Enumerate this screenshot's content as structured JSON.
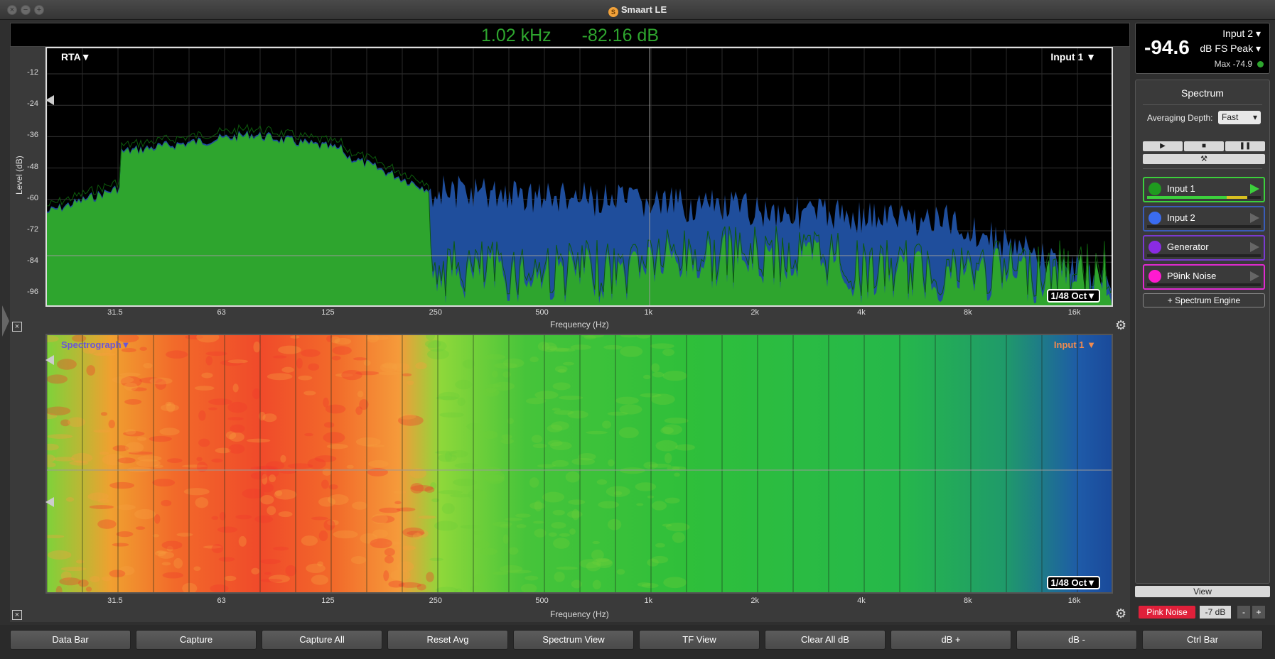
{
  "window": {
    "title": "Smaart LE"
  },
  "readout": {
    "frequency": "1.02 kHz",
    "level": "-82.16 dB"
  },
  "rta": {
    "type_label": "RTA",
    "input_label": "Input 1",
    "resolution": "1/48 Oct",
    "y_label": "Level (dB)",
    "x_label": "Frequency (Hz)",
    "y_ticks": [
      "-12",
      "-24",
      "-36",
      "-48",
      "-60",
      "-72",
      "-84",
      "-96"
    ],
    "x_ticks": [
      "31.5",
      "63",
      "125",
      "250",
      "500",
      "1k",
      "2k",
      "4k",
      "8k",
      "16k"
    ]
  },
  "spectrograph": {
    "type_label": "Spectrograph",
    "input_label": "Input 1",
    "resolution": "1/48 Oct",
    "x_label": "Frequency (Hz)",
    "x_ticks": [
      "31.5",
      "63",
      "125",
      "250",
      "500",
      "1k",
      "2k",
      "4k",
      "8k",
      "16k"
    ]
  },
  "meter": {
    "value": "-94.6",
    "input_select": "Input 2",
    "mode_select": "dB FS Peak",
    "max": "Max -74.9",
    "status_color": "#2ea52e"
  },
  "side_panel": {
    "title": "Spectrum",
    "averaging_label": "Averaging Depth:",
    "averaging_value": "Fast",
    "transport": {
      "play": "▶",
      "stop": "■",
      "pause": "❚❚",
      "tools": "⚒"
    },
    "channels": [
      {
        "label": "Input 1",
        "color": "#1f9a1f",
        "border": "#3cd03c"
      },
      {
        "label": "Input 2",
        "color": "#3a6cf0",
        "border": "#3a5cb8"
      },
      {
        "label": "Generator",
        "color": "#8a2be2",
        "border": "#7a3ad0"
      },
      {
        "label": "P9ink Noise",
        "color": "#ff1ad0",
        "border": "#e02ad0"
      }
    ],
    "add_engine": "+ Spectrum Engine"
  },
  "view_button": "View",
  "generator": {
    "pink_label": "Pink Noise",
    "level": "-7 dB",
    "minus": "-",
    "plus": "+"
  },
  "bottom_buttons": [
    "Data Bar",
    "Capture",
    "Capture All",
    "Reset Avg",
    "Spectrum View",
    "TF View",
    "Clear All dB",
    "dB +",
    "dB -",
    "Ctrl Bar"
  ],
  "colors": {
    "rta_green": "#2ea52e",
    "rta_blue": "#1f4e9c",
    "accent_pink": "#e0203a"
  }
}
